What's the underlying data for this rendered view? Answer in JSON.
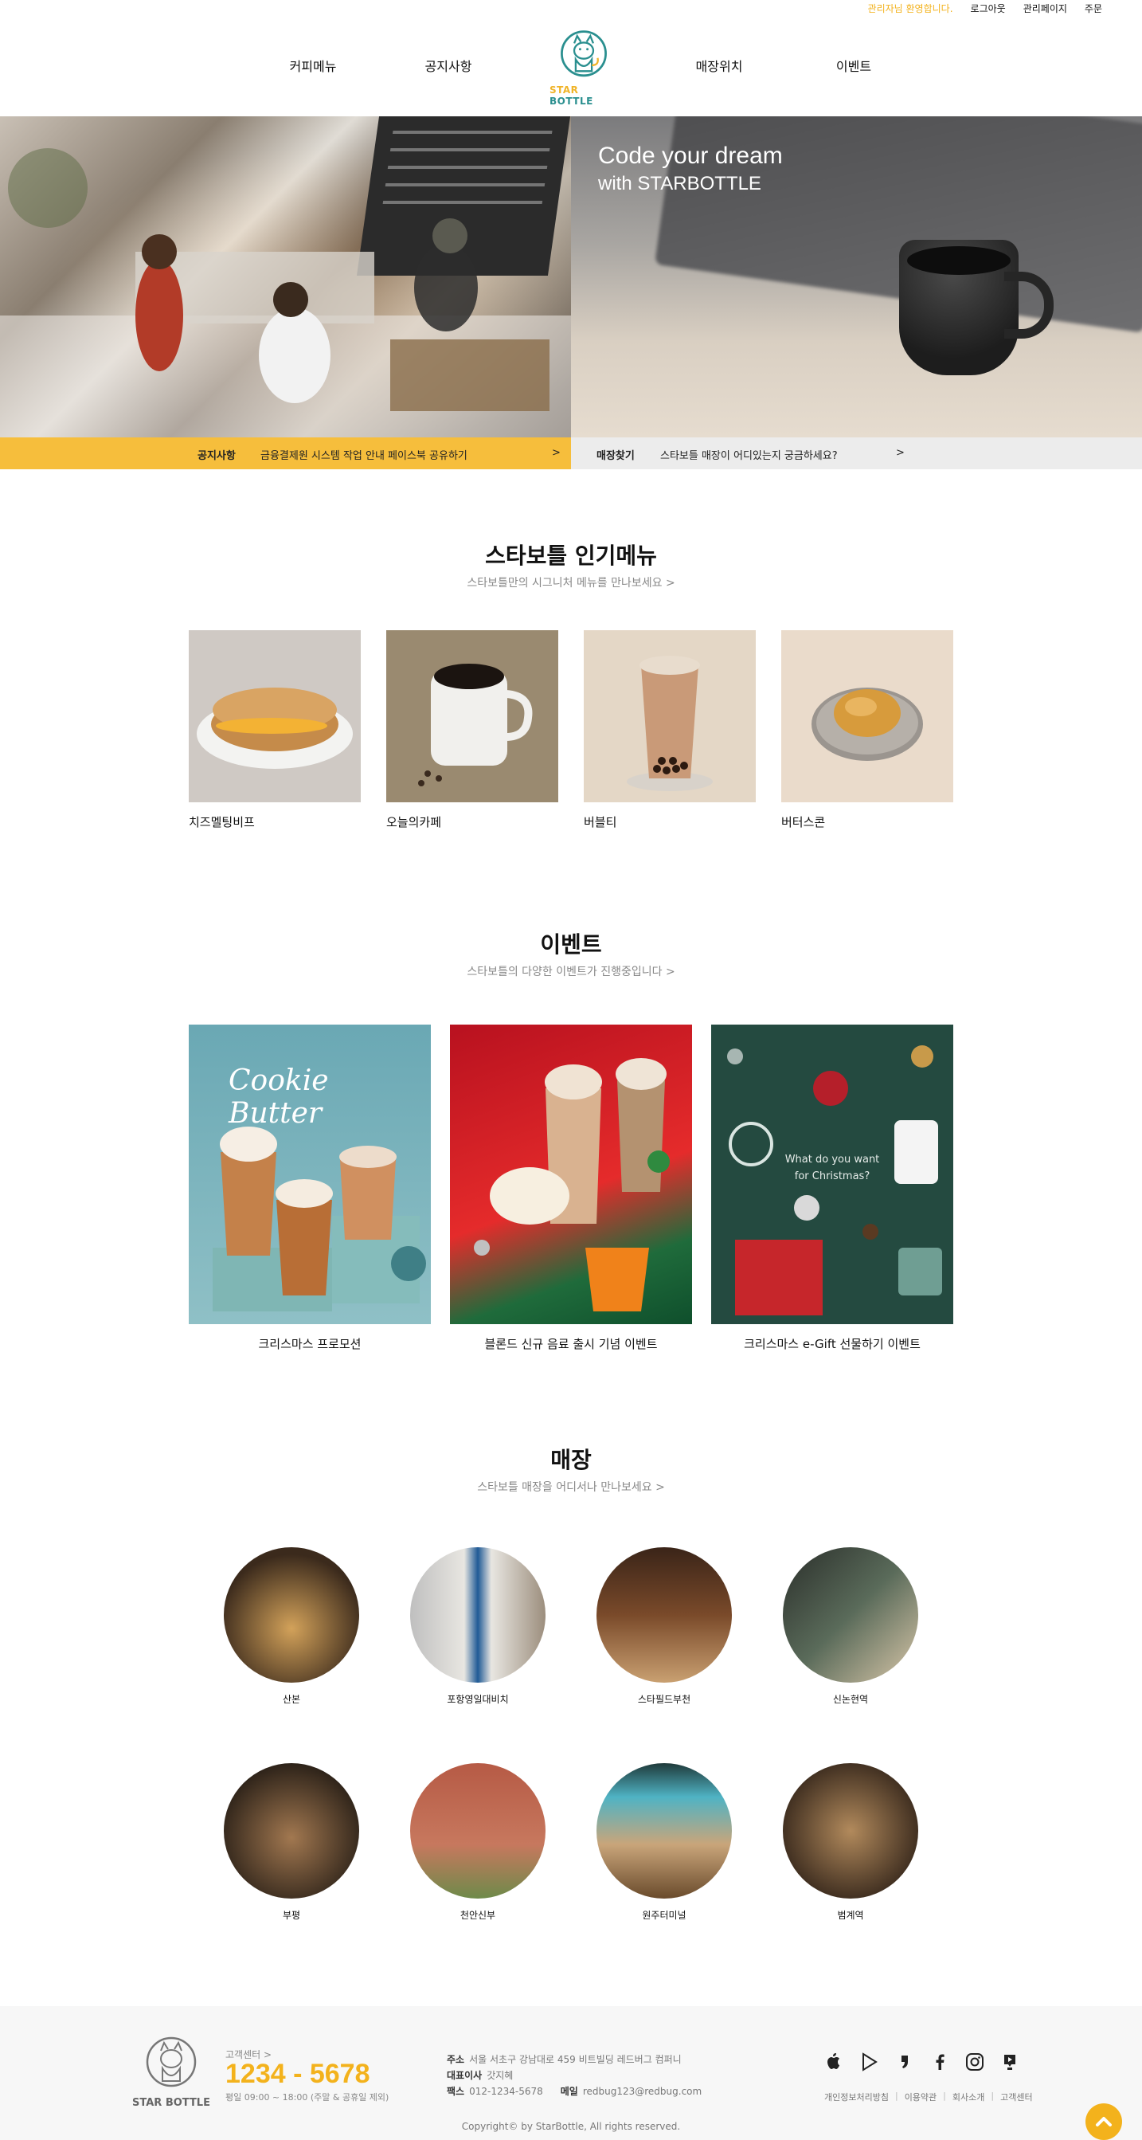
{
  "util_bar": {
    "welcome": "관리자님 환영합니다.",
    "logout": "로그아웃",
    "admin": "관리페이지",
    "order": "주문"
  },
  "nav": {
    "items": [
      "커피메뉴",
      "공지사항",
      "매장위치",
      "이벤트"
    ],
    "logo_text_1": "STAR",
    "logo_text_2": "BOTTLE"
  },
  "hero": {
    "title_line1": "Code your dream",
    "title_line2": "with STARBOTTLE",
    "notice_label": "공지사항",
    "notice_text": "금융결제원 시스템 작업 안내 페이스북 공유하기",
    "notice_arrow": ">",
    "store_label": "매장찾기",
    "store_text": "스타보틀 매장이 어디있는지 궁금하세요?",
    "store_arrow": ">"
  },
  "popular": {
    "title": "스타보틀 인기메뉴",
    "subtitle": "스타보틀만의 시그니처 메뉴를 만나보세요 >",
    "items": [
      "치즈멜팅비프",
      "오늘의카페",
      "버블티",
      "버터스콘"
    ]
  },
  "events": {
    "title": "이벤트",
    "subtitle": "스타보틀의 다양한 이벤트가 진행중입니다 >",
    "items": [
      "크리스마스 프로모션",
      "블론드 신규 음료 출시 기념 이벤트",
      "크리스마스 e-Gift 선물하기 이벤트"
    ],
    "cookie_text": "Cookie Butter",
    "xmas_text_1": "What do you want",
    "xmas_text_2": "for Christmas?"
  },
  "stores": {
    "title": "매장",
    "subtitle": "스타보틀 매장을 어디서나 만나보세요 >",
    "items": [
      "산본",
      "포항영일대비치",
      "스타필드부천",
      "신논현역",
      "부평",
      "천안신부",
      "원주터미널",
      "범계역"
    ]
  },
  "footer": {
    "logo_text": "STAR BOTTLE",
    "cs_label": "고객센터 >",
    "phone": "1234 - 5678",
    "hours": "평일 09:00 ~ 18:00 (주말 & 공휴일 제외)",
    "address_label": "주소",
    "address": "서울 서초구 강남대로 459 비트빌딩 레드버그 컴퍼니",
    "ceo_label": "대표이사",
    "ceo": "갓지혜",
    "fax_label": "팩스",
    "fax": "012-1234-5678",
    "email_label": "메일",
    "email": "redbug123@redbug.com",
    "copyright": "Copyright© by StarBottle, All rights reserved.",
    "links": [
      "개인정보처리방침",
      "이용약관",
      "회사소개",
      "고객센터"
    ],
    "icons": [
      "apple-icon",
      "google-play-icon",
      "blog-icon",
      "facebook-icon",
      "instagram-icon",
      "youtube-icon"
    ]
  },
  "colors": {
    "accent": "#f3b21c",
    "notice_bar": "#f6be3c",
    "store_bar": "#ececec",
    "logo_teal": "#2a8f8f"
  }
}
